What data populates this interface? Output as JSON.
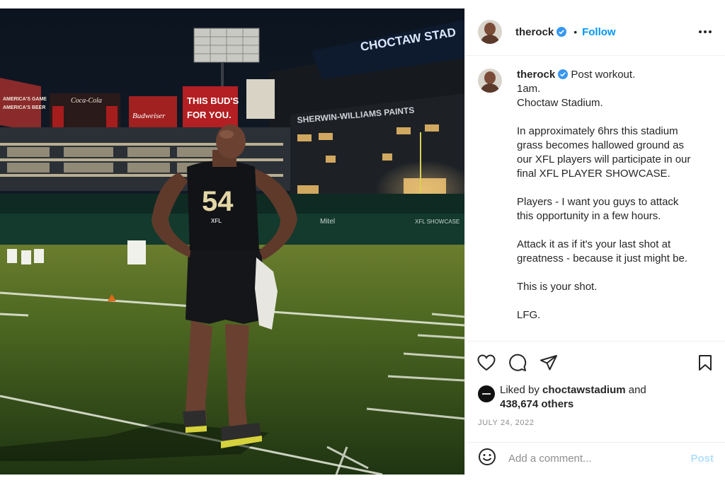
{
  "post": {
    "username": "therock",
    "verified": true,
    "follow_label": "Follow",
    "header_separator": "•"
  },
  "photo": {
    "stadium_sign": "CHOCTAW STAD",
    "banner_budweiser": "Budweiser",
    "banner_slogan_1": "THIS BUD'S",
    "banner_slogan_2": "FOR YOU.",
    "banner_sherwin": "SHERWIN-WILLIAMS PAINTS",
    "banner_americas_1": "AMERICA'S GAME",
    "banner_americas_2": "AMERICA'S BEER",
    "banner_coke": "Coca-Cola",
    "jersey_number": "54",
    "jersey_logo": "XFL",
    "wall_sponsor": "Mitel",
    "wall_sponsor_2": "XFL SHOWCASE"
  },
  "caption": {
    "username": "therock",
    "first_line": "Post workout.",
    "lines": [
      "1am.",
      "Choctaw Stadium.",
      "",
      "In approximately 6hrs this stadium",
      "grass becomes hallowed ground as",
      "our XFL players will participate in our",
      "final XFL PLAYER SHOWCASE.",
      "",
      "Players - I want you guys to attack",
      "this opportunity in a few hours.",
      "",
      "Attack it as if it's your last shot at",
      "greatness - because it just might be.",
      "",
      "This is your shot.",
      "",
      "LFG."
    ]
  },
  "actions": {
    "icons": [
      "heart-icon",
      "comment-icon",
      "share-icon",
      "bookmark-icon"
    ]
  },
  "likes": {
    "prefix": "Liked by",
    "user": "choctawstadium",
    "conjunction": "and",
    "others": "438,674 others"
  },
  "date": "JULY 24, 2022",
  "comment_box": {
    "placeholder": "Add a comment...",
    "post_label": "Post",
    "emoji_icon": "emoji-icon"
  },
  "colors": {
    "accent": "#0095f6",
    "post_disabled": "#b2dffc",
    "muted": "#8e8e8e",
    "text": "#262626"
  }
}
